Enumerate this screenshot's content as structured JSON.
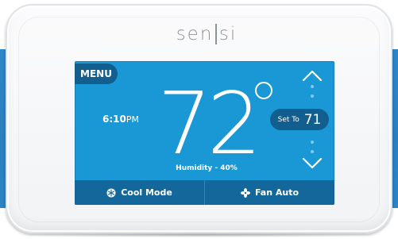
{
  "device": {
    "brand_left": "sen",
    "brand_right": "si"
  },
  "screen": {
    "menu_label": "MENU",
    "time_value": "6:10",
    "time_ampm": "PM",
    "temperature": "72",
    "humidity": "Humidity - 40%",
    "set_to_label": "Set To",
    "set_to_value": "71",
    "mode_label": "Cool Mode",
    "fan_label": "Fan Auto",
    "accent_color": "#1a97d5",
    "dark_accent_color": "#125f8f"
  },
  "icons": {
    "mode_icon": "snowflake-icon",
    "fan_icon": "fan-icon",
    "up_icon": "chevron-up-icon",
    "down_icon": "chevron-down-icon"
  }
}
